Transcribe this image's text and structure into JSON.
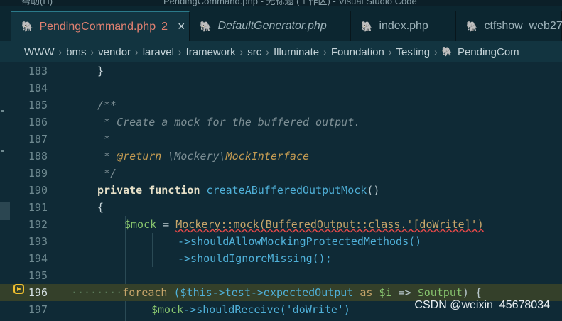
{
  "window": {
    "menu_fragment": "帮助(H)",
    "title_fragment": "PendingCommand.php - 无标题 (工作区) - Visual Studio Code"
  },
  "tabs": [
    {
      "label": "PendingCommand.php",
      "badge": "2",
      "close": "×"
    },
    {
      "label": "DefaultGenerator.php"
    },
    {
      "label": "index.php"
    },
    {
      "label": "ctfshow_web27"
    }
  ],
  "breadcrumb": {
    "segments": [
      "WWW",
      "bms",
      "vendor",
      "laravel",
      "framework",
      "src",
      "Illuminate",
      "Foundation",
      "Testing"
    ],
    "file": "PendingCom",
    "separator": "›"
  },
  "editor": {
    "line_numbers": [
      "183",
      "184",
      "185",
      "186",
      "187",
      "188",
      "189",
      "190",
      "191",
      "192",
      "193",
      "194",
      "195",
      "196",
      "197"
    ],
    "code": {
      "l183": "}",
      "l185": "/**",
      "l186": " * Create a mock for the buffered output.",
      "l187": " *",
      "l188_a": " * ",
      "l188_b": "@return",
      "l188_c": " \\Mockery\\",
      "l188_d": "MockInterface",
      "l189": " */",
      "l190_kw": "private function",
      "l190_fn": "createABufferedOutputMock",
      "l190_p": "()",
      "l191": "{",
      "l192_var": "$mock",
      "l192_eq": " = ",
      "l192_a": "Mockery::mock(BufferedOutput::class.'[doWrite]')",
      "l193": "->shouldAllowMockingProtectedMethods()",
      "l194": "->shouldIgnoreMissing();",
      "l196_dots": "········",
      "l196_kw": "foreach",
      "l196_a": " ($this->test->expectedOutput",
      "l196_as": " as ",
      "l196_i": "$i",
      "l196_arrow": " => ",
      "l196_out": "$output",
      "l196_end": ") {",
      "l197_var": "$mock",
      "l197_a": "->shouldReceive('doWrite')"
    }
  },
  "watermark": "CSDN @weixin_45678034"
}
